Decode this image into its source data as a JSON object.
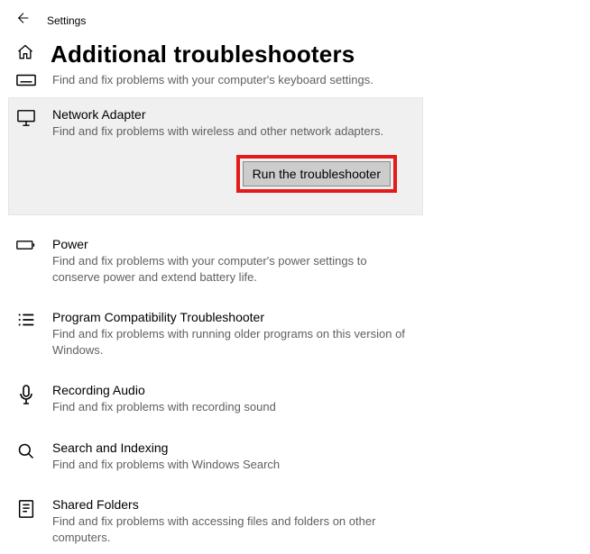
{
  "header": {
    "title": "Settings"
  },
  "page": {
    "heading": "Additional troubleshooters"
  },
  "top_orphan_desc": "Find and fix problems with your computer's keyboard settings.",
  "items": [
    {
      "title": "Network Adapter",
      "desc": "Find and fix problems with wireless and other network adapters.",
      "action": "Run the troubleshooter"
    },
    {
      "title": "Power",
      "desc": "Find and fix problems with your computer's power settings to conserve power and extend battery life."
    },
    {
      "title": "Program Compatibility Troubleshooter",
      "desc": "Find and fix problems with running older programs on this version of Windows."
    },
    {
      "title": "Recording Audio",
      "desc": "Find and fix problems with recording sound"
    },
    {
      "title": "Search and Indexing",
      "desc": "Find and fix problems with Windows Search"
    },
    {
      "title": "Shared Folders",
      "desc": "Find and fix problems with accessing files and folders on other computers."
    }
  ]
}
